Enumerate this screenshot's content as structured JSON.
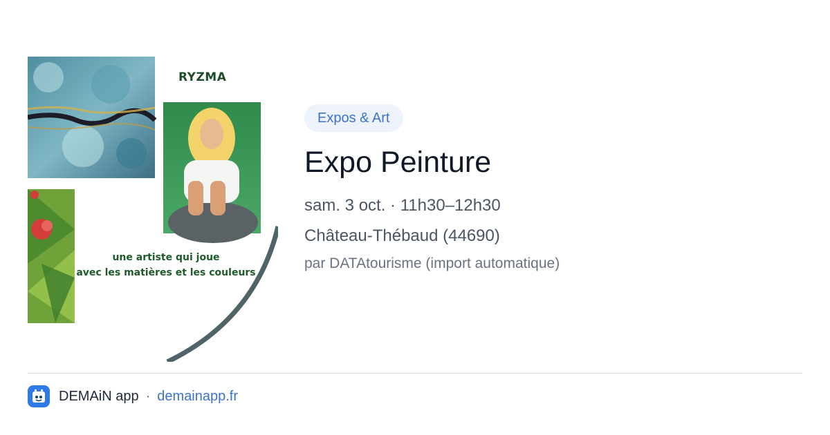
{
  "image": {
    "artist": "RYZMA",
    "tagline_lines": [
      "une artiste qui joue",
      "avec les matières et les couleurs"
    ]
  },
  "event": {
    "category": "Expos & Art",
    "title": "Expo Peinture",
    "datetime": "sam. 3 oct. · 11h30–12h30",
    "location": "Château-Thébaud (44690)",
    "source": "par DATAtourisme (import automatique)"
  },
  "footer": {
    "app_name": "DEMAiN app",
    "separator": "·",
    "url": "demainapp.fr",
    "icon": "app-logo-icon"
  },
  "colors": {
    "accent": "#3b73c9",
    "pill_bg": "#eef3fb",
    "title": "#111827",
    "text": "#4b5563",
    "muted": "#6b7280",
    "divider": "#d8e0e8"
  }
}
